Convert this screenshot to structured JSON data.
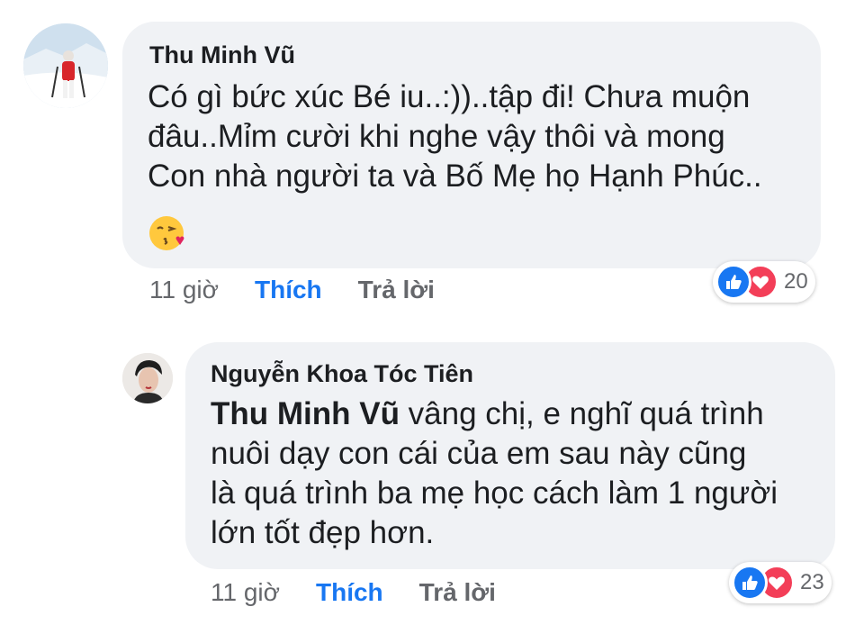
{
  "comments": [
    {
      "author": "Thu Minh Vũ",
      "lines": [
        "Có gì bức xúc Bé iu..:))..tập đi! Chưa muộn",
        "đâu..Mỉm cười khi nghe vậy thôi và mong",
        "Con nhà người ta và Bố Mẹ họ Hạnh Phúc.."
      ],
      "emoji": "face-blowing-kiss-icon",
      "time": "11 giờ",
      "like_label": "Thích",
      "reply_label": "Trả lời",
      "reaction_count": "20"
    },
    {
      "author": "Nguyễn Khoa Tóc Tiên",
      "mention": "Thu Minh Vũ",
      "first_line_rest": " vâng chị, e nghĩ quá trình",
      "lines": [
        "nuôi dạy con cái của em sau này cũng",
        "là quá trình ba mẹ học cách làm 1 người",
        "lớn tốt đẹp hơn."
      ],
      "time": "11 giờ",
      "like_label": "Thích",
      "reply_label": "Trả lời",
      "reaction_count": "23"
    }
  ],
  "colors": {
    "bubble": "#f0f2f5",
    "like_blue": "#1877f2",
    "love_red": "#f33e58",
    "meta_gray": "#65676b"
  }
}
